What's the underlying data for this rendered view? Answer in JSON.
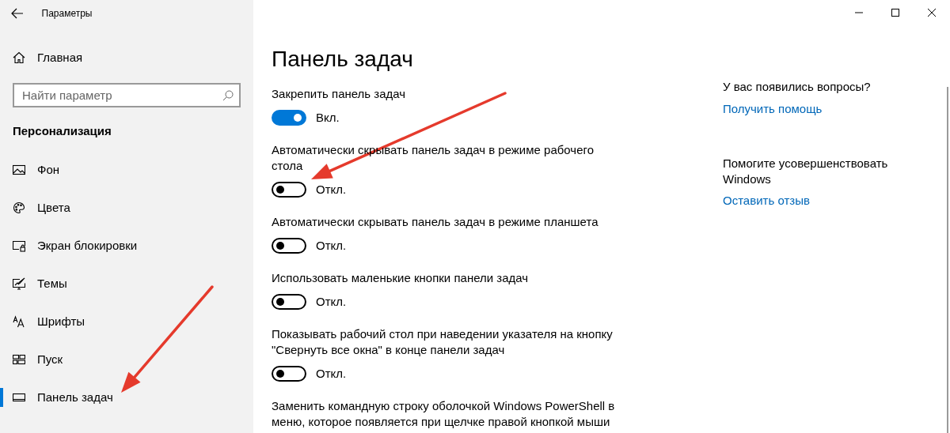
{
  "window": {
    "title": "Параметры"
  },
  "sidebar": {
    "home": "Главная",
    "search": {
      "placeholder": "Найти параметр"
    },
    "section": "Персонализация",
    "items": [
      {
        "label": "Фон",
        "selected": false
      },
      {
        "label": "Цвета",
        "selected": false
      },
      {
        "label": "Экран блокировки",
        "selected": false
      },
      {
        "label": "Темы",
        "selected": false
      },
      {
        "label": "Шрифты",
        "selected": false
      },
      {
        "label": "Пуск",
        "selected": false
      },
      {
        "label": "Панель задач",
        "selected": true
      }
    ]
  },
  "page": {
    "title": "Панель задач",
    "settings": [
      {
        "kind": "toggle",
        "label": "Закрепить панель задач",
        "on": true,
        "state": "Вкл."
      },
      {
        "kind": "toggle",
        "label": "Автоматически скрывать панель задач в режиме рабочего стола",
        "on": false,
        "state": "Откл."
      },
      {
        "kind": "toggle",
        "label": "Автоматически скрывать панель задач в режиме планшета",
        "on": false,
        "state": "Откл."
      },
      {
        "kind": "toggle",
        "label": "Использовать маленькие кнопки панели задач",
        "on": false,
        "state": "Откл."
      },
      {
        "kind": "toggle",
        "label": "Показывать рабочий стол при наведении указателя на кнопку \"Свернуть все окна\" в конце панели задач",
        "on": false,
        "state": "Откл."
      },
      {
        "kind": "label-only",
        "label": "Заменить командную строку оболочкой Windows PowerShell в меню, которое появляется при щелчке правой кнопкой мыши"
      }
    ]
  },
  "help": {
    "question": "У вас появились вопросы?",
    "link": "Получить помощь"
  },
  "feedback": {
    "text": "Помогите усовершенствовать Windows",
    "link": "Оставить отзыв"
  },
  "annotations": [
    {
      "kind": "arrow"
    },
    {
      "kind": "arrow"
    }
  ]
}
